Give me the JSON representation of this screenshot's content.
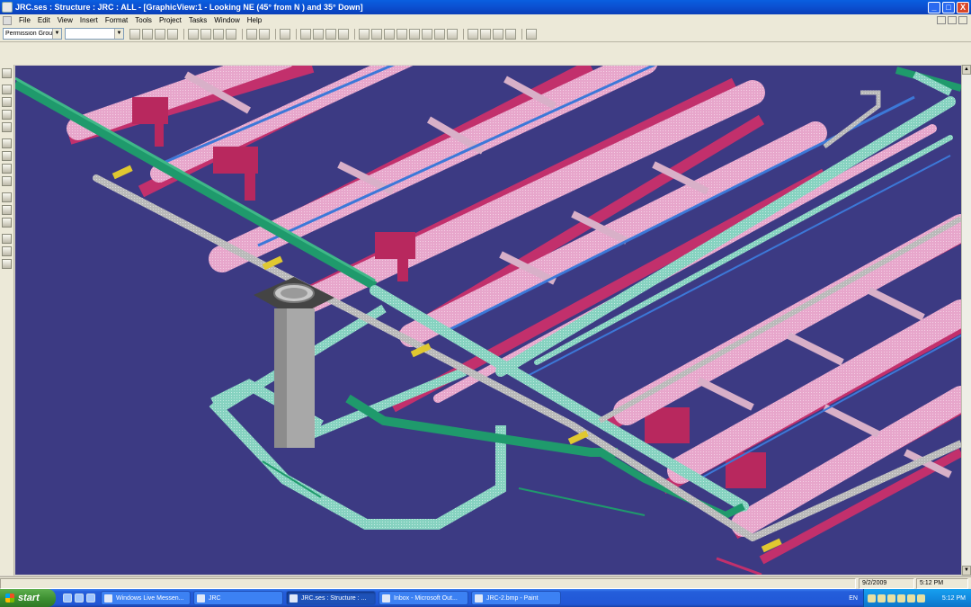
{
  "window": {
    "title": "JRC.ses : Structure : JRC : ALL - [GraphicView:1 - Looking NE (45° from N ) and 35° Down]",
    "minimize": "_",
    "maximize": "□",
    "close": "X"
  },
  "menu": {
    "items": [
      "File",
      "Edit",
      "View",
      "Insert",
      "Format",
      "Tools",
      "Project",
      "Tasks",
      "Window",
      "Help"
    ]
  },
  "toolbar": {
    "permission_combo": "Permission Group",
    "style_combo": "",
    "icons": [
      "new-icon",
      "open-icon",
      "save-icon",
      "print-icon",
      "cut-icon",
      "copy-icon",
      "paste-icon",
      "delete-icon",
      "undo-icon",
      "select-icon",
      "zoom-icon",
      "help-icon"
    ]
  },
  "status": {
    "date": "9/2/2009",
    "time": "5:12 PM"
  },
  "taskbar": {
    "start_label": "start",
    "buttons": [
      {
        "label": "Windows Live Messen...",
        "active": false
      },
      {
        "label": "JRC",
        "active": false
      },
      {
        "label": "JRC.ses : Structure : ...",
        "active": true
      },
      {
        "label": "Inbox - Microsoft Out...",
        "active": false
      },
      {
        "label": "JRC-2.bmp - Paint",
        "active": false
      }
    ],
    "language": "EN",
    "clock": "5:12 PM"
  },
  "colors": {
    "viewport_bg": "#3c3a83",
    "pink_pipe": "#e8a0c8",
    "magenta_steel": "#c8306e",
    "green_pipe": "#2aa878",
    "teal_pipe": "#8ed8c8",
    "grey_pipe": "#b8b8b8"
  }
}
